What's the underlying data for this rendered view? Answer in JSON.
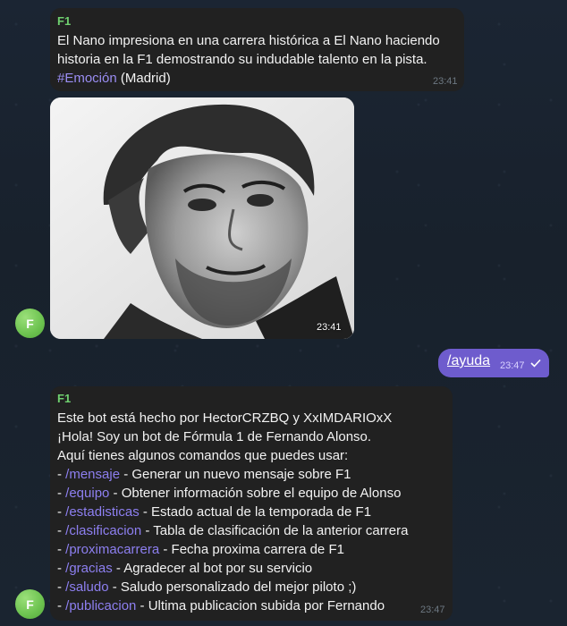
{
  "messages": {
    "bot1": {
      "sender": "F1",
      "text_main": "El Nano impresiona en una carrera histórica a El Nano haciendo historia en la F1 demostrando su indudable talento en la pista. ",
      "hashtag": "#Emoción",
      "location": " (Madrid)",
      "time": "23:41",
      "avatar_letter": "F"
    },
    "photo": {
      "time": "23:41",
      "description_icon": "portrait-photo"
    },
    "user": {
      "text": "/ayuda",
      "time": "23:47",
      "status_icon": "check-icon"
    },
    "bot2": {
      "sender": "F1",
      "intro_lines": [
        "Este bot está hecho por HectorCRZBQ y XxIMDARIOxX",
        "¡Hola! Soy un bot de Fórmula 1 de Fernando Alonso.",
        "Aquí tienes algunos comandos que puedes usar:"
      ],
      "commands": [
        {
          "cmd": "/mensaje",
          "desc": " - Generar un nuevo mensaje sobre F1"
        },
        {
          "cmd": "/equipo",
          "desc": " - Obtener información sobre el equipo de Alonso"
        },
        {
          "cmd": "/estadisticas",
          "desc": " - Estado actual de la temporada de F1"
        },
        {
          "cmd": "/clasificacion",
          "desc": " - Tabla de clasificación de la anterior carrera"
        },
        {
          "cmd": "/proximacarrera",
          "desc": " - Fecha proxima carrera de F1"
        },
        {
          "cmd": "/gracias",
          "desc": " - Agradecer al bot por su servicio"
        },
        {
          "cmd": "/saludo",
          "desc": " - Saludo personalizado del mejor piloto ;)"
        },
        {
          "cmd": "/publicacion",
          "desc": " - Ultima publicacion subida por Fernando"
        }
      ],
      "bullet": " - ",
      "time": "23:47",
      "avatar_letter": "F"
    }
  },
  "colors": {
    "bubble_in": "#212121",
    "bubble_out": "#6e5ccd",
    "sender": "#6fd06f",
    "link": "#8d7ff0"
  }
}
